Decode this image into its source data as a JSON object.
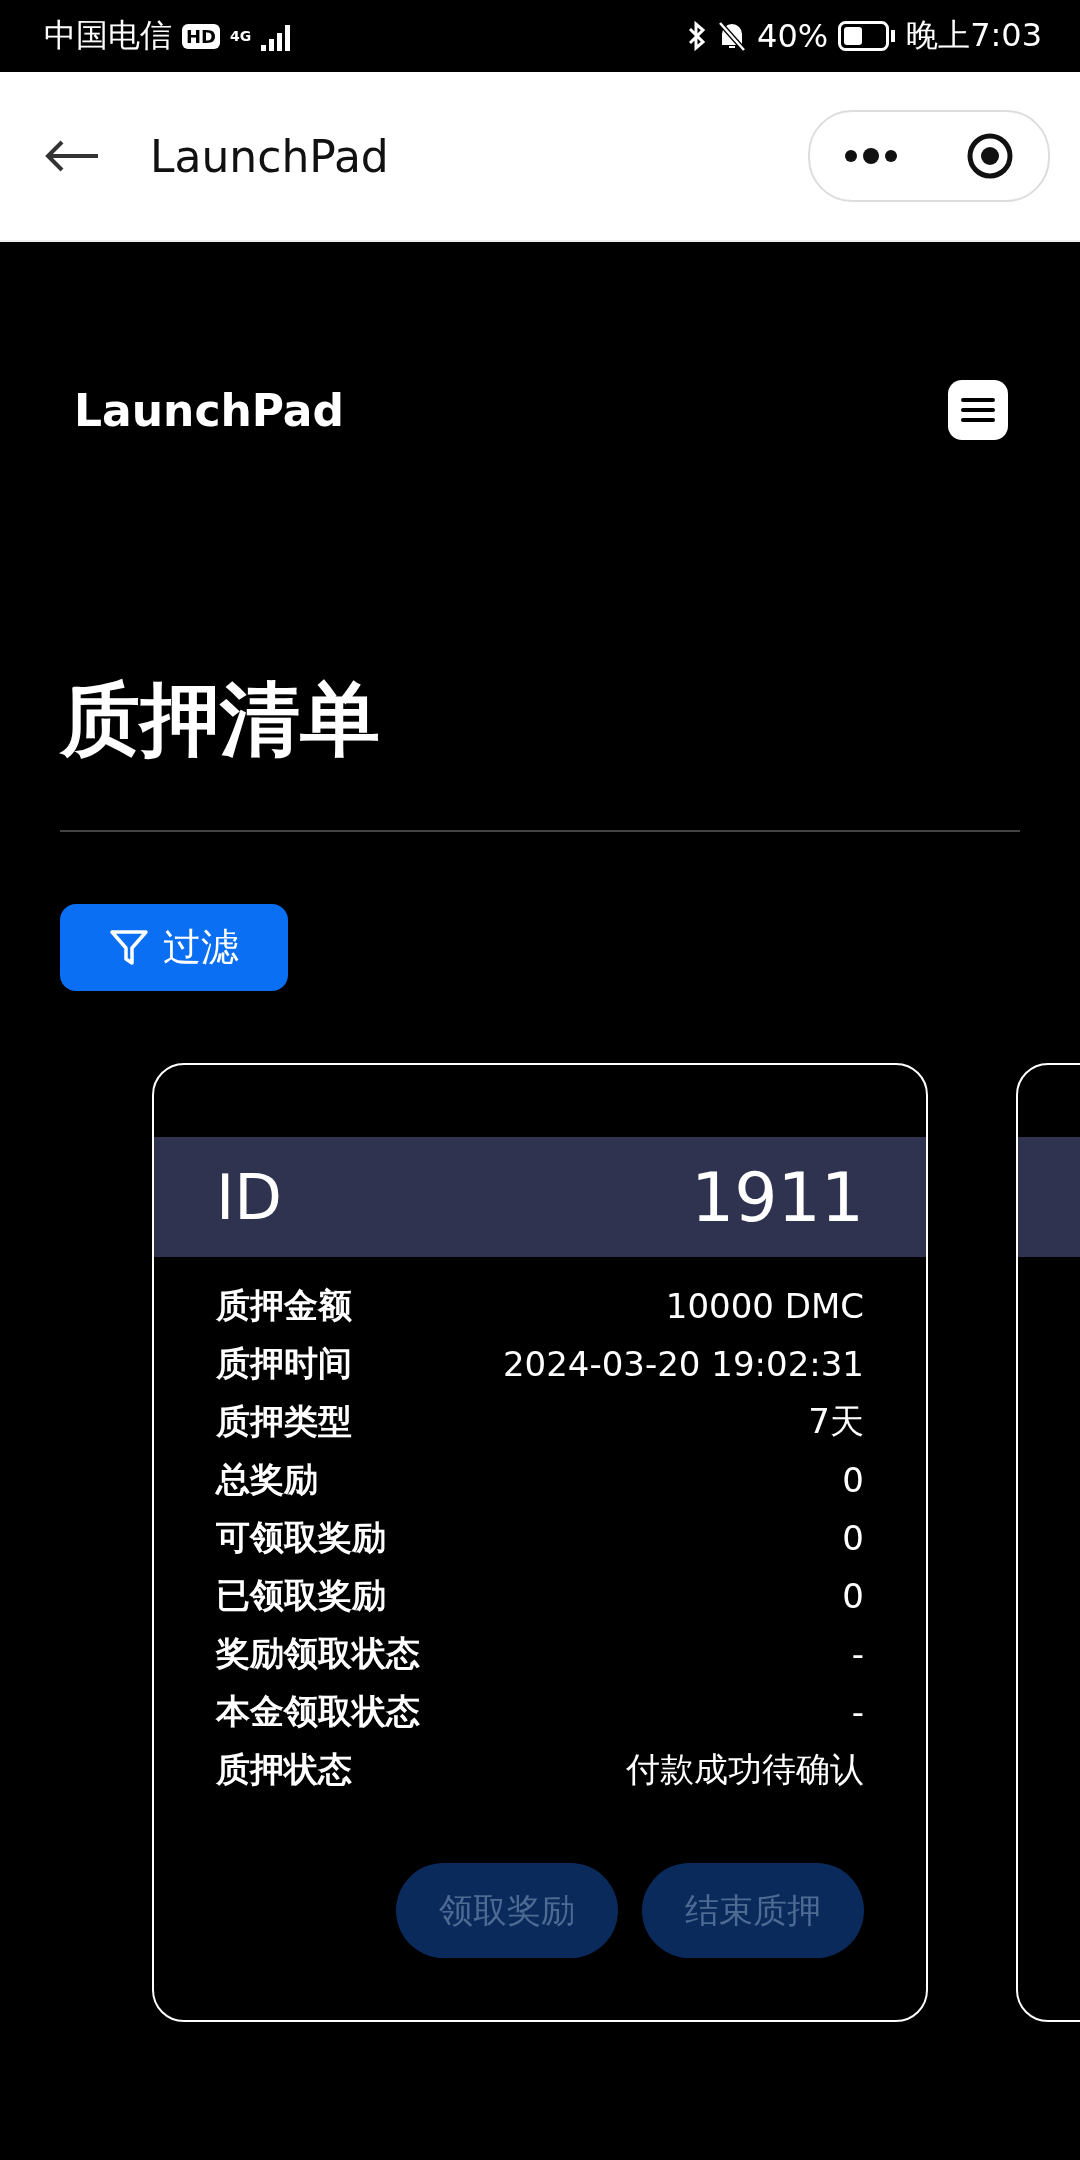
{
  "status_bar": {
    "carrier": "中国电信",
    "hd": "HD",
    "network": "4G",
    "battery": "40%",
    "time": "晚上7:03"
  },
  "nav_bar": {
    "title": "LaunchPad"
  },
  "header": {
    "brand": "LaunchPad"
  },
  "page_title": "质押清单",
  "filter_button": {
    "label": "过滤"
  },
  "cards": [
    {
      "id_label": "ID",
      "id_value": "1911",
      "rows": [
        {
          "label": "质押金额",
          "value": "10000 DMC"
        },
        {
          "label": "质押时间",
          "value": "2024-03-20 19:02:31"
        },
        {
          "label": "质押类型",
          "value": "7天"
        },
        {
          "label": "总奖励",
          "value": "0"
        },
        {
          "label": "可领取奖励",
          "value": "0"
        },
        {
          "label": "已领取奖励",
          "value": "0"
        },
        {
          "label": "奖励领取状态",
          "value": "-"
        },
        {
          "label": "本金领取状态",
          "value": "-"
        },
        {
          "label": "质押状态",
          "value": "付款成功待确认"
        }
      ],
      "buttons": [
        {
          "label": "领取奖励",
          "disabled": true
        },
        {
          "label": "结束质押",
          "disabled": true
        }
      ]
    }
  ]
}
